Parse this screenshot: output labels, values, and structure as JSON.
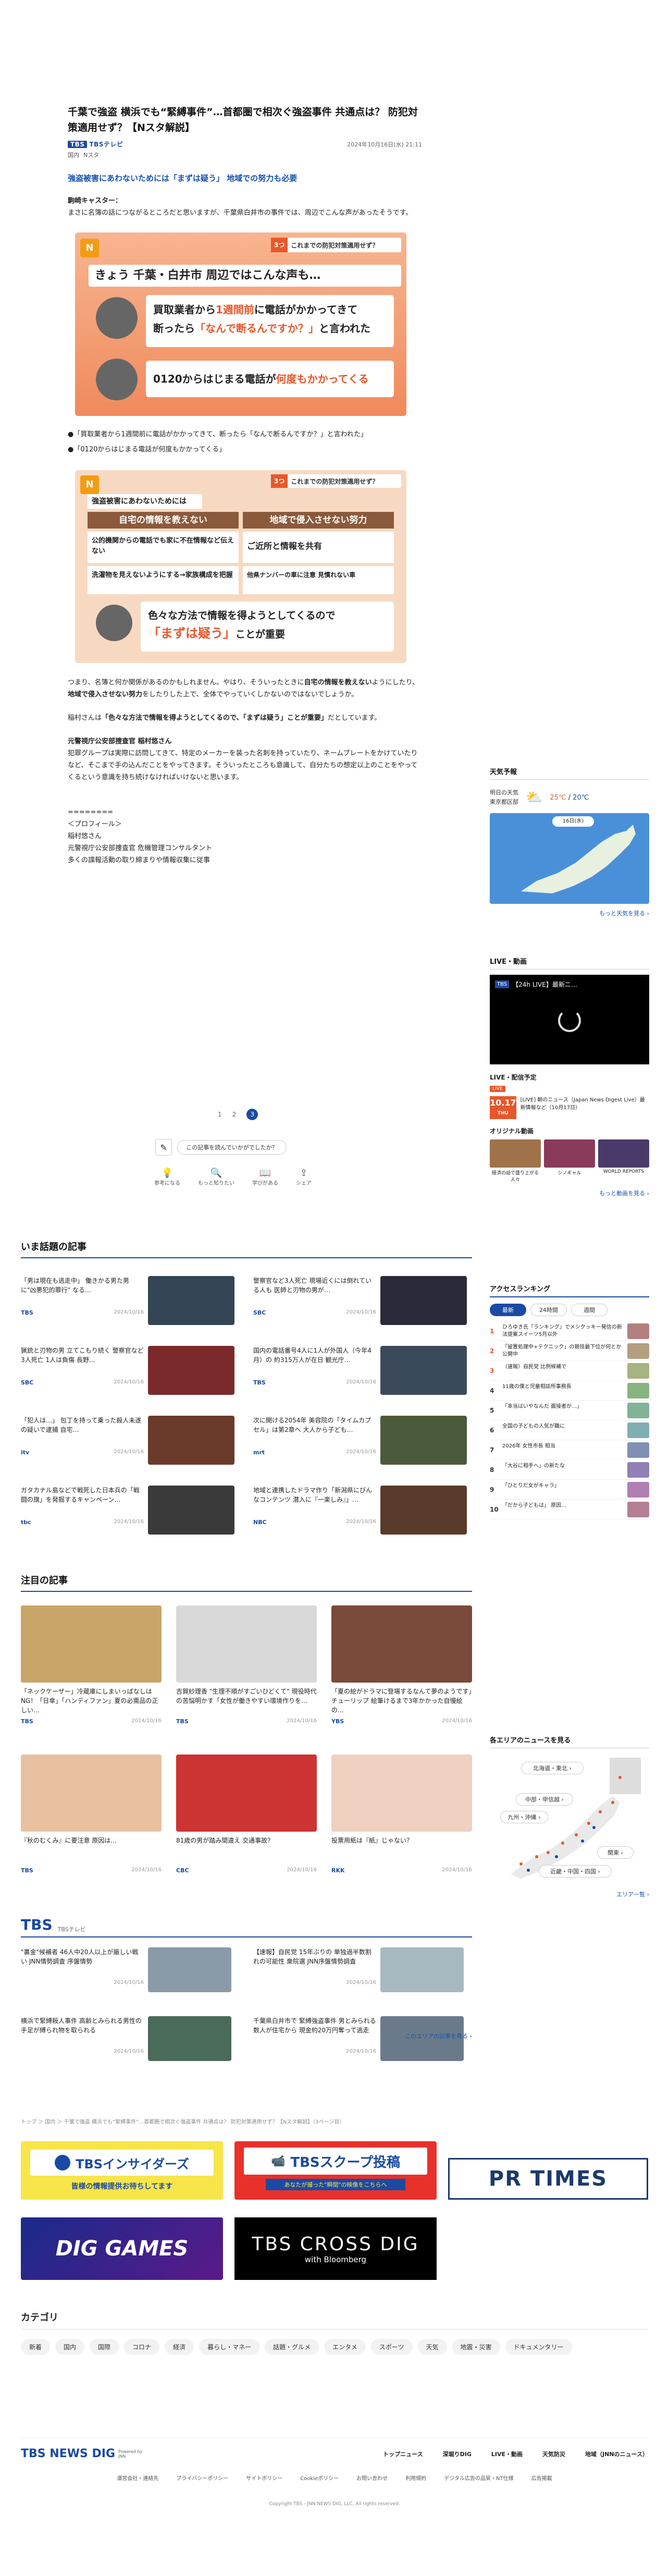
{
  "article": {
    "title": "千葉で強盗 横浜でも“緊縛事件”…首都圏で相次ぐ強盗事件 共通点は？ 防犯対策適用せず？【Nスタ解説】",
    "publisher": "TBSテレビ",
    "date": "2024年10月16日(水) 21:11",
    "tags": [
      "国内",
      "Nスタ"
    ],
    "lead": "強盗被害にあわないためには「まずは疑う」 地域での努力も必要",
    "speaker1": "駒崎キャスター：",
    "para1": "まさに名簿の話につながるところだと思いますが、千葉県白井市の事件では、周辺でこんな声があったそうです。",
    "bullet1": "●「買取業者から1週間前に電話がかかってきて、断ったら「なんで断るんですか？」と言われた」",
    "bullet2": "●「0120からはじまる電話が何度もかかってくる」",
    "para2a": "つまり、名簿と何か関係があるのかもしれません。やはり、そういったときに",
    "para2b": "自宅の情報を教えない",
    "para2c": "ようにしたり、",
    "para2d": "地域で侵入させない努力",
    "para2e": "をしたりした上で、全体でやっていくしかないのではないでしょうか。",
    "para3a": "稲村さんは",
    "para3b": "「色々な方法で情報を得ようとしてくるので、「まずは疑う」ことが重要」",
    "para3c": "だとしています。",
    "speaker2": "元警視庁公安部捜査官 稲村悠さん",
    "para4": "犯罪グループは実際に訪問してきて、特定のメーカーを装った名刺を持っていたり、ネームプレートをかけていたりなど、そこまで手の込んだことをやってきます。そういったところも意識して、自分たちの想定以上のことをやってくるという意識を持ち続けなければいけないと思います。",
    "divider": "========",
    "profile_h": "＜プロフィール＞",
    "profile1": "稲村悠さん",
    "profile2": "元警視庁公安部捜査官 危機管理コンサルタント",
    "profile3": "多くの諜報活動の取り締まりや情報収集に従事",
    "pages": [
      "1",
      "2",
      "3"
    ],
    "feedback_q": "この記事を読んでいかがでしたか？",
    "reactions": [
      "参考になる",
      "もっと知りたい",
      "学びがある",
      "シェア"
    ]
  },
  "fig1": {
    "corner": "3つ",
    "corner_title": "これまでの防犯対策適用せず？",
    "banner": "きょう 千葉・白井市 周辺ではこんな声も…",
    "box1_a": "買取業者から",
    "box1_b": "1週間前",
    "box1_c": "に電話がかかってきて",
    "box1_d": "断ったら",
    "box1_e": "「なんで断るんですか？」",
    "box1_f": "と言われた",
    "box2_a": "0120からはじまる電話が",
    "box2_b": "何度もかかってくる"
  },
  "fig2": {
    "corner": "3つ",
    "corner_title": "これまでの防犯対策適用せず？",
    "banner": "強盗被害にあわないためには",
    "col1": "自宅の情報を教えない",
    "col2": "地域で侵入させない努力",
    "item1": "公的機関からの電話でも家に不在情報など伝えない",
    "item2": "洗濯物を見えないようにする→家族構成を把握",
    "item3": "ご近所と情報を共有",
    "item4": "他県ナンバーの車に注意 見慣れない車",
    "bottom_a": "色々な方法で情報を得ようとしてくるので",
    "bottom_b": "「まずは疑う」",
    "bottom_c": "ことが重要"
  },
  "weather": {
    "title": "天気予報",
    "place1": "明日の天気",
    "place2": "東京都区部",
    "temp_hi": "25℃",
    "temp_lo": "20℃",
    "date": "16日(水)",
    "more": "もっと天気を見る ›"
  },
  "live": {
    "title": "LIVE・動画",
    "player": "【24h LIVE】最新ニ…",
    "sched_title": "LIVE・配信予定",
    "badge": "LIVE",
    "date": "10.17",
    "date_sub": "THU",
    "desc": "[LIVE] 朝のニュース（Japan News Digest Live）最新情報など（10月17日）",
    "original": "オリジナル動画",
    "v1": "経済の話で盛り上がる人々",
    "v2": "シノギャル",
    "v3": "WORLD REPORTS",
    "more": "もっと動画を見る ›"
  },
  "ranking": {
    "title": "アクセスランキング",
    "tabs": [
      "最新",
      "24時間",
      "週間"
    ],
    "items": [
      "ひろゆき氏『ランキング』でメシクッキー発信の新法提案スイーツ5月以外",
      "「留置処理中+テクニック」の競技最下位が何とか公開中",
      "（速報）自民党 比例候補で",
      "11歳の僕と児童相談所事務長",
      "「本当はいやなんだ 面接者が…」",
      "全国の子どもの人気が職に",
      "2026年 女性市長 相当",
      "「大谷に相手へ」の新たな",
      "「ひとりだ女がキャラ」",
      "「だから子どもは」 原因…"
    ]
  },
  "areas": {
    "title": "各エリアのニュースを見る",
    "pills": [
      "北海道・東北 ›",
      "中部・甲信越 ›",
      "九州・沖縄 ›",
      "関東 ›",
      "近畿・中国・四国 ›"
    ],
    "more": "エリア一覧 ›"
  },
  "popular": {
    "title": "いま話題の記事",
    "items": [
      {
        "text": "「男は現在も逃走中」 働きかる男た男に\"凶悪犯的罪行\" なる…",
        "src": "TBS",
        "date": "2024/10/16"
      },
      {
        "text": "警察官など3人死亡 現場近くには倒れている人も 医師と刃物の男が…",
        "src": "SBC",
        "date": "2024/10/16"
      },
      {
        "text": "猟銃と刃物の男 立てこもり続く 警察官など3人死亡 1人は負傷 長野…",
        "src": "SBC",
        "date": "2024/10/16"
      },
      {
        "text": "国内の電話番号4人に1人が外国人（今年4月）の 約315万人が在日 観光庁…",
        "src": "TBS",
        "date": "2024/10/16"
      },
      {
        "text": "「犯人は…」 包丁を持って乗った殺人未遂の疑いで逮捕 自宅…",
        "src": "itv",
        "date": "2024/10/16"
      },
      {
        "text": "次に開ける2054年 美容院の「タイムカプセル」は第2章へ 大人から子ども…",
        "src": "mrt",
        "date": "2024/10/16"
      },
      {
        "text": "ガタカナル島などで戦死した日本兵の「戦闘の旗」を発掘するキャンペーン…",
        "src": "tbc",
        "date": "2024/10/16"
      },
      {
        "text": "地域と連携したドラマ作り「新潟県にぴんなコンテンツ 潜入に『一楽しみ』」…",
        "src": "NBC",
        "date": "2024/10/16"
      }
    ]
  },
  "featured": {
    "title": "注目の記事",
    "items": [
      {
        "text": "「ネックケーザー」冷蔵庫にしまいっぱなしはNG！「日傘」「ハンディファン」夏の必需品の正しい…",
        "src": "TBS",
        "date": "2024/10/16"
      },
      {
        "text": "吉賀紗理香 \"生理不順がすごいひどくて\" 現役時代の苦悩明かす「女性が働きやすい環境作りを…",
        "src": "TBS",
        "date": "2024/10/16"
      },
      {
        "text": "「夏の絵がドラマに登場するなんて夢のようです」チューリップ 絵筆けるまで3年かかった自慢絵の…",
        "src": "YBS",
        "date": "2024/10/16"
      },
      {
        "text": "『秋のむくみ』に要注意 原因は…",
        "src": "TBS",
        "date": "2024/10/16"
      },
      {
        "text": "81歳の男が踏み間違え 交通事故？",
        "src": "CBC",
        "date": "2024/10/16"
      },
      {
        "text": "投票用紙は『紙』じゃない？",
        "src": "RKK",
        "date": "2024/10/16"
      }
    ]
  },
  "tbs_block": {
    "title": "TBS",
    "sub": "TBSテレビ",
    "items": [
      {
        "text": "\"裏金\"候補者 46人中20人以上が厳しい戦い JNN情勢調査 序盤情勢",
        "date": "2024/10/16"
      },
      {
        "text": "【速報】自民党 15年ぶりの 単独過半数割れの可能性 衆院選 JNN序盤情勢調査",
        "date": "2024/10/16"
      },
      {
        "text": "横浜で緊縛殺人事件 高齢とみられる男性の手足が縛られ物を取られる",
        "date": "2024/10/16"
      },
      {
        "text": "千葉県白井市で 緊縛強盗事件 男とみられる数人が住宅から 現金約20万円奪って逃走",
        "date": "2024/10/16"
      }
    ],
    "more": "このエリアの記事を見る ›"
  },
  "breadcrumb": "トップ ＞ 国内 ＞ 千葉で強盗 横浜でも“緊縛事件”…首都圏で相次ぐ強盗事件 共通点は？ 防犯対策適用せず？【Nスタ解説】（3ページ目）",
  "banners": {
    "b1": "TBSインサイダーズ",
    "b1_sub": "皆様の情報提供お待ちしてます",
    "b2": "TBSスクープ投稿",
    "b2_sub": "あなたが撮った\"瞬間\"の映像をこちらへ",
    "b3": "PR TIMES",
    "b4": "DIG GAMES",
    "b5a": "TBS CROSS DIG",
    "b5b": "with Bloomberg"
  },
  "categories": {
    "title": "カテゴリ",
    "items": [
      "新着",
      "国内",
      "国際",
      "コロナ",
      "経済",
      "暮らし・マネー",
      "話題・グルメ",
      "エンタメ",
      "スポーツ",
      "天気",
      "地震・災害",
      "ドキュメンタリー"
    ]
  },
  "footer": {
    "brand": "TBS NEWS DIG",
    "brand_sub": "Powered by JNN",
    "nav": [
      "トップニュース",
      "深堀りDIG",
      "LIVE・動画",
      "天気防災",
      "地域（JNNのニュース）"
    ],
    "links": [
      "運営会社・連絡先",
      "プライバシーポリシー",
      "サイトポリシー",
      "Cookieポリシー",
      "お問い合わせ",
      "利用規約",
      "デジタル広告の品質・NT仕様",
      "広告掲載"
    ],
    "copyright": "Copyright TBS - JNN NEWS DIG, LLC. All rights reserved."
  },
  "colors": {
    "accent": "#1a4aa3",
    "link": "#1651b0",
    "orange": "#e8572a"
  }
}
